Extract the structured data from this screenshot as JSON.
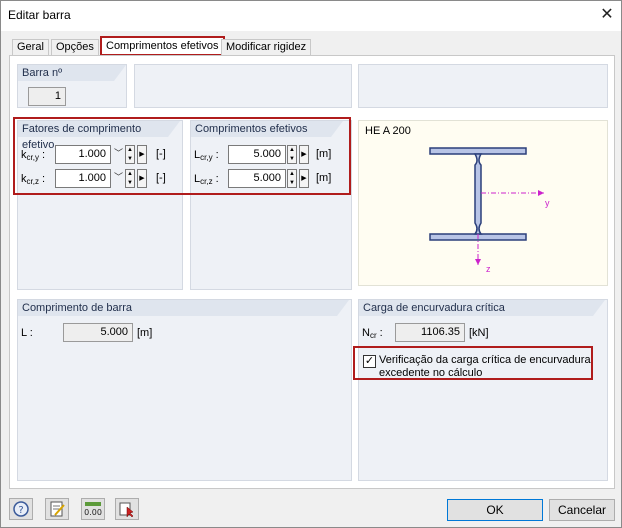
{
  "window": {
    "title": "Editar barra",
    "close_glyph": "✕"
  },
  "tabs": [
    {
      "label": "Geral"
    },
    {
      "label": "Opções"
    },
    {
      "label": "Comprimentos efetivos"
    },
    {
      "label": "Modificar rigidez"
    }
  ],
  "member": {
    "header": "Barra nº",
    "value": "1"
  },
  "factors": {
    "header": "Fatores de comprimento efetivo",
    "ky_label": "k",
    "ky_sub": "cr,y",
    "ky_colon": " :",
    "ky_value": "1.000",
    "ky_unit": "[-]",
    "kz_label": "k",
    "kz_sub": "cr,z",
    "kz_colon": " :",
    "kz_value": "1.000",
    "kz_unit": "[-]"
  },
  "lengths": {
    "header": "Comprimentos efetivos",
    "ly_label": "L",
    "ly_sub": "cr,y",
    "ly_colon": " :",
    "ly_value": "5.000",
    "ly_unit": "[m]",
    "lz_label": "L",
    "lz_sub": "cr,z",
    "lz_colon": " :",
    "lz_value": "5.000",
    "lz_unit": "[m]"
  },
  "section": {
    "name": "HE A 200",
    "axis_y": "y",
    "axis_z": "z"
  },
  "member_length": {
    "header": "Comprimento de barra",
    "label": "L :",
    "value": "5.000",
    "unit": "[m]"
  },
  "critical_load": {
    "header": "Carga de encurvadura crítica",
    "label": "N",
    "label_sub": "cr",
    "colon": " :",
    "value": "1106.35",
    "unit": "[kN]",
    "check_label_line1": "Verificação da carga crítica de encurvadura",
    "check_label_line2": "excedente no cálculo",
    "checked": true
  },
  "buttons": {
    "ok": "OK",
    "cancel": "Cancelar"
  },
  "toolbar_icons": [
    "help-icon",
    "edit-icon",
    "units-icon",
    "select-icon"
  ],
  "colors": {
    "accent_red": "#b01c1c",
    "section_fill": "#b8c4e6",
    "axis_magenta": "#cc22cc",
    "group_bg": "#eef1f6"
  }
}
